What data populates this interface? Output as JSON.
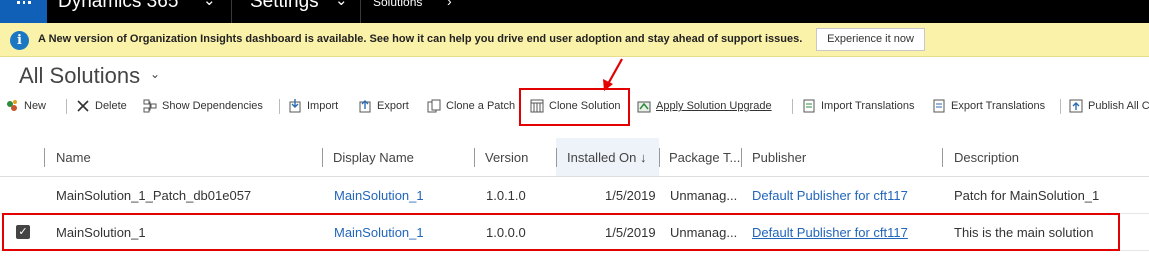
{
  "topnav": {
    "app_name": "Dynamics 365",
    "area": "Settings",
    "breadcrumb": "Solutions"
  },
  "notification": {
    "message": "A New version of Organization Insights dashboard is available. See how it can help you drive end user adoption and stay ahead of support issues.",
    "button": "Experience it now"
  },
  "page": {
    "title": "All Solutions"
  },
  "toolbar": {
    "new": "New",
    "delete": "Delete",
    "show_dependencies": "Show Dependencies",
    "import": "Import",
    "export": "Export",
    "clone_patch": "Clone a Patch",
    "clone_solution": "Clone Solution",
    "apply_upgrade": "Apply Solution Upgrade",
    "import_translations": "Import Translations",
    "export_translations": "Export Translations",
    "publish_all": "Publish All C"
  },
  "grid": {
    "columns": {
      "name": "Name",
      "display_name": "Display Name",
      "version": "Version",
      "installed_on": "Installed On",
      "package_type": "Package T...",
      "publisher": "Publisher",
      "description": "Description"
    },
    "rows": [
      {
        "name": "MainSolution_1_Patch_db01e057",
        "display_name": "MainSolution_1",
        "version": "1.0.1.0",
        "installed_on": "1/5/2019",
        "package_type": "Unmanag...",
        "publisher": "Default Publisher for cft117",
        "description": "Patch for MainSolution_1"
      },
      {
        "name": "MainSolution_1",
        "display_name": "MainSolution_1",
        "version": "1.0.0.0",
        "installed_on": "1/5/2019",
        "package_type": "Unmanag...",
        "publisher": "Default Publisher for cft117",
        "description": "This is the main solution",
        "selected": true
      }
    ]
  },
  "colors": {
    "nav_bg": "#000000",
    "waffle_bg": "#1160b7",
    "notification_bg": "#fbf2a9",
    "link": "#2266bb",
    "highlight": "#e30000"
  }
}
